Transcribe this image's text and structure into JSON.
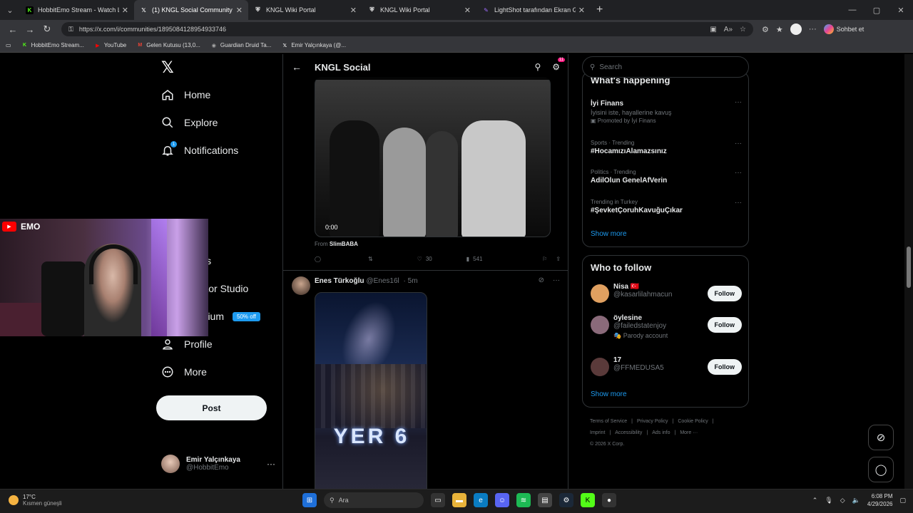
{
  "browser": {
    "tabs": [
      {
        "title": "HobbitEmo Stream - Watch Live o",
        "icon": "kick-icon",
        "color": "#53fc18",
        "active": false
      },
      {
        "title": "(1) KNGL Social Community / X",
        "icon": "x-icon",
        "color": "#ffffff",
        "active": true
      },
      {
        "title": "KNGL Wiki Portal",
        "icon": "shield-icon",
        "color": "#ffffff",
        "active": false
      },
      {
        "title": "KNGL Wiki Portal",
        "icon": "shield-icon",
        "color": "#ffffff",
        "active": false
      },
      {
        "title": "LightShot tarafından Ekran Görünt",
        "icon": "feather-icon",
        "color": "#a06cff",
        "active": false
      }
    ],
    "url": "https://x.com/i/communities/1895084128954933746",
    "copilot_label": "Sohbet et",
    "bookmarks": [
      {
        "label": "HobbitEmo Stream...",
        "icon": "kick-icon",
        "color": "#53fc18"
      },
      {
        "label": "YouTube",
        "icon": "youtube-icon",
        "color": "#ff0000"
      },
      {
        "label": "Gelen Kutusu (13,0...",
        "icon": "gmail-icon",
        "color": "#ea4335"
      },
      {
        "label": "Guardian Druid Ta...",
        "icon": "druid-icon",
        "color": "#aaaaaa"
      },
      {
        "label": "Emir Yalçınkaya (@...",
        "icon": "x-icon",
        "color": "#ffffff"
      }
    ]
  },
  "leftnav": {
    "items": [
      {
        "label": "Home",
        "icon": "home-icon"
      },
      {
        "label": "Explore",
        "icon": "search-icon"
      },
      {
        "label": "Notifications",
        "icon": "bell-icon",
        "badge": "1"
      },
      {
        "label": "Bookmarks",
        "visible_label": "marks",
        "icon": "bookmark-icon"
      },
      {
        "label": "Creator Studio",
        "icon": "rocket-icon"
      },
      {
        "label": "Premium",
        "icon": "x-icon",
        "badge": "50% off"
      },
      {
        "label": "Profile",
        "icon": "person-icon"
      },
      {
        "label": "More",
        "icon": "more-circle-icon"
      }
    ],
    "post_label": "Post",
    "user": {
      "name": "Emir Yalçınkaya",
      "handle": "@HobbitEmo"
    }
  },
  "webcam": {
    "label": "EMO"
  },
  "main": {
    "title": "KNGL Social",
    "settings_badge": "11",
    "video_time": "0:00",
    "from_prefix": "From",
    "from_name": "SlimBABA",
    "tweet1_stats": {
      "likes": "30",
      "views": "541"
    },
    "tweet2": {
      "name": "Enes Türkoğlu",
      "handle": "@Enes16l",
      "time": "· 5m",
      "image_text": "YER 6"
    }
  },
  "right": {
    "search_placeholder": "Search",
    "whats_happening_title": "What's happening",
    "trends": [
      {
        "meta": "",
        "title": "İyi Finans",
        "sub": "İyisini iste, hayallerine kavuş",
        "promo": "Promoted by İyi Finans"
      },
      {
        "meta": "Sports · Trending",
        "title": "#HocamızıAlamazsınız",
        "sub": "",
        "promo": ""
      },
      {
        "meta": "Politics · Trending",
        "title": "AdilOlun GenelAfVerin",
        "sub": "",
        "promo": ""
      },
      {
        "meta": "Trending in Turkey",
        "title": "#ŞevketÇoruhKavuğuÇıkar",
        "sub": "",
        "promo": ""
      }
    ],
    "show_more": "Show more",
    "who_to_follow_title": "Who to follow",
    "follow_label": "Follow",
    "suggestions": [
      {
        "name": "Nisa 🇹🇷",
        "handle": "@kasarlilahmacun",
        "note": "",
        "avatar_color": "#e0a060"
      },
      {
        "name": "öylesine",
        "handle": "@failedstatenjoy",
        "note": "🎭 Parody account",
        "avatar_color": "#8a6a7a"
      },
      {
        "name": "17",
        "handle": "@FFMEDUSA5",
        "note": "",
        "avatar_color": "#5a3a3a"
      }
    ],
    "footer": [
      "Terms of Service",
      "|",
      "Privacy Policy",
      "|",
      "Cookie Policy",
      "|",
      "Imprint",
      "|",
      "Accessibility",
      "|",
      "Ads info",
      "|",
      "More ···",
      "© 2026 X Corp."
    ]
  },
  "taskbar": {
    "temp": "17°C",
    "weather": "Kısmen güneşli",
    "search": "Ara",
    "time": "6:08 PM",
    "date": "4/29/2026"
  }
}
